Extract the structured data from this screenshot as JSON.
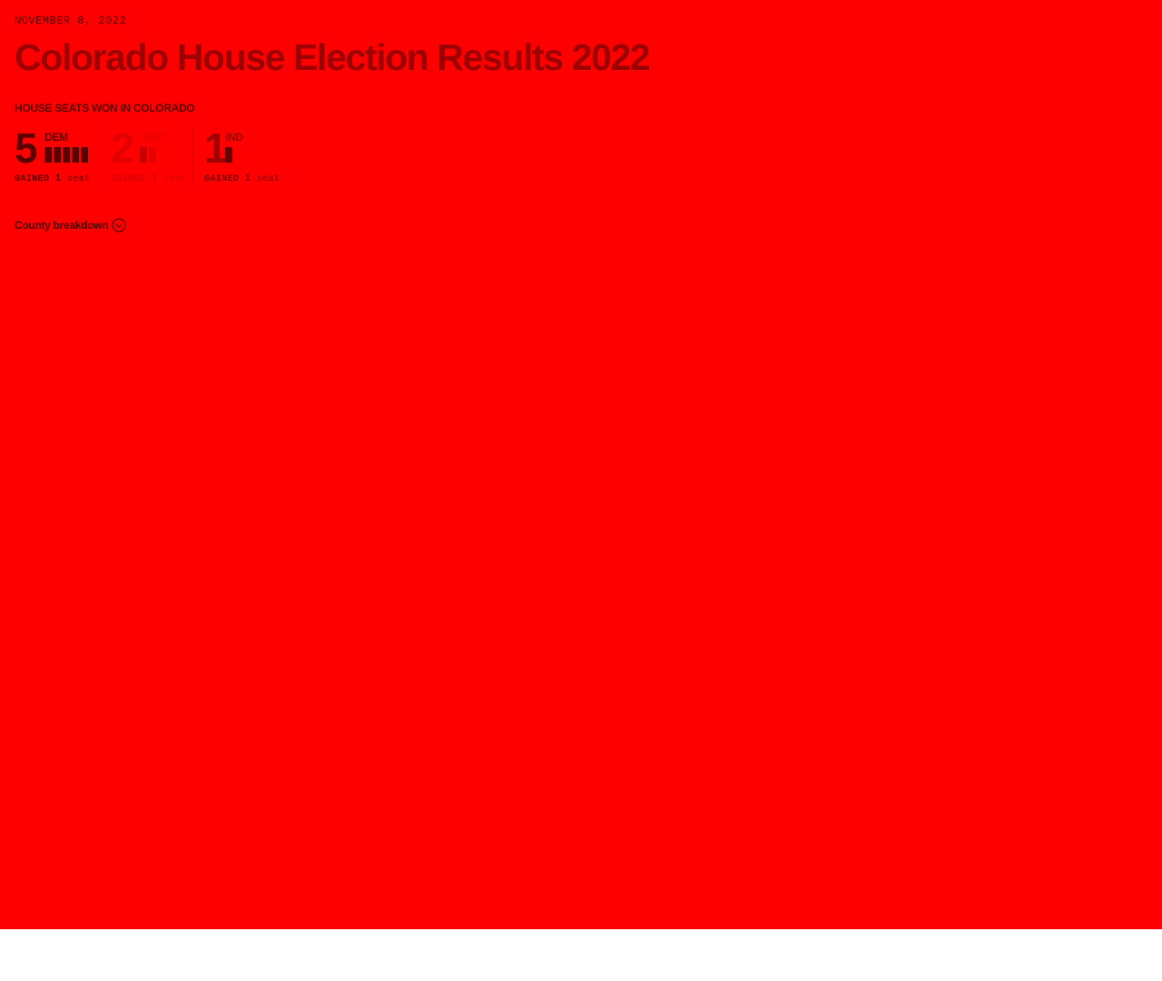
{
  "header": {
    "date": "NOVEMBER 8, 2022",
    "title": "Colorado House Election Results 2022"
  },
  "seats": {
    "heading": "HOUSE SEATS WON IN COLORADO",
    "parties": [
      {
        "party": "DEM",
        "seats": "5",
        "bars": 5,
        "gained_label": "GAINED",
        "gained_count": "1",
        "gained_unit": "seat",
        "color": "#5c0000"
      },
      {
        "party": "GOP",
        "seats": "2",
        "bars": 2,
        "gained_label": "GAINED",
        "gained_count": "1",
        "gained_unit": "seat",
        "color": "#e30000"
      },
      {
        "party": "IND",
        "seats": "1",
        "bars": 1,
        "gained_label": "GAINED",
        "gained_count": "1",
        "gained_unit": "seat",
        "color": "#a00000"
      }
    ]
  },
  "county_breakdown": {
    "label": "County breakdown",
    "icon": "chevron-down-circle-icon"
  },
  "colors": {
    "background": "#ff0000",
    "title": "#9c0000"
  }
}
